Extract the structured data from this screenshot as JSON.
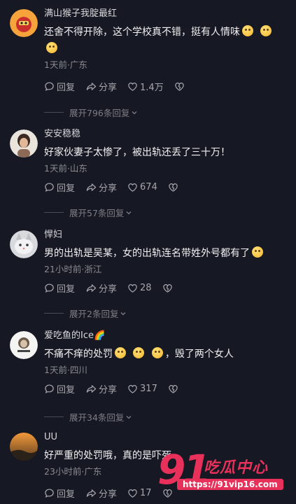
{
  "comments": [
    {
      "username": "满山猴子我腚最红",
      "text": "还舍不得开除，这个学校真不错，挺有人情味",
      "emoji_count": 3,
      "meta": "1天前·广东",
      "reply_label": "回复",
      "share_label": "分享",
      "likes": "1.4万",
      "expand_label": "展开796条回复"
    },
    {
      "username": "安安稳稳",
      "text": "好家伙妻子太惨了，被出轨还丢了三十万！",
      "emoji_count": 0,
      "meta": "1天前·山东",
      "reply_label": "回复",
      "share_label": "分享",
      "likes": "674",
      "expand_label": "展开57条回复"
    },
    {
      "username": "悍妇",
      "text": "男的出轨是吴某，女的出轨连名带姓外号都有了",
      "emoji_count": 1,
      "meta": "21小时前·浙江",
      "reply_label": "回复",
      "share_label": "分享",
      "likes": "28",
      "expand_label": "展开2条回复"
    },
    {
      "username": "爱吃鱼的Ice🌈",
      "text_a": "不痛不痒的处罚",
      "text_b": "，毁了两个女人",
      "emoji_count": 3,
      "meta": "1天前·四川",
      "reply_label": "回复",
      "share_label": "分享",
      "likes": "317",
      "expand_label": "展开34条回复"
    },
    {
      "username": "UU",
      "text": "好严重的处罚哦，真的是吓死",
      "emoji_count": 0,
      "meta": "23小时前·广东",
      "reply_label": "回复",
      "share_label": "分享",
      "likes": "17"
    }
  ],
  "watermark": {
    "number": "91",
    "title": "吃瓜中心",
    "url": "https://91vip16.com"
  },
  "colors": {
    "background": "#161823",
    "accent": "#e8315a"
  }
}
